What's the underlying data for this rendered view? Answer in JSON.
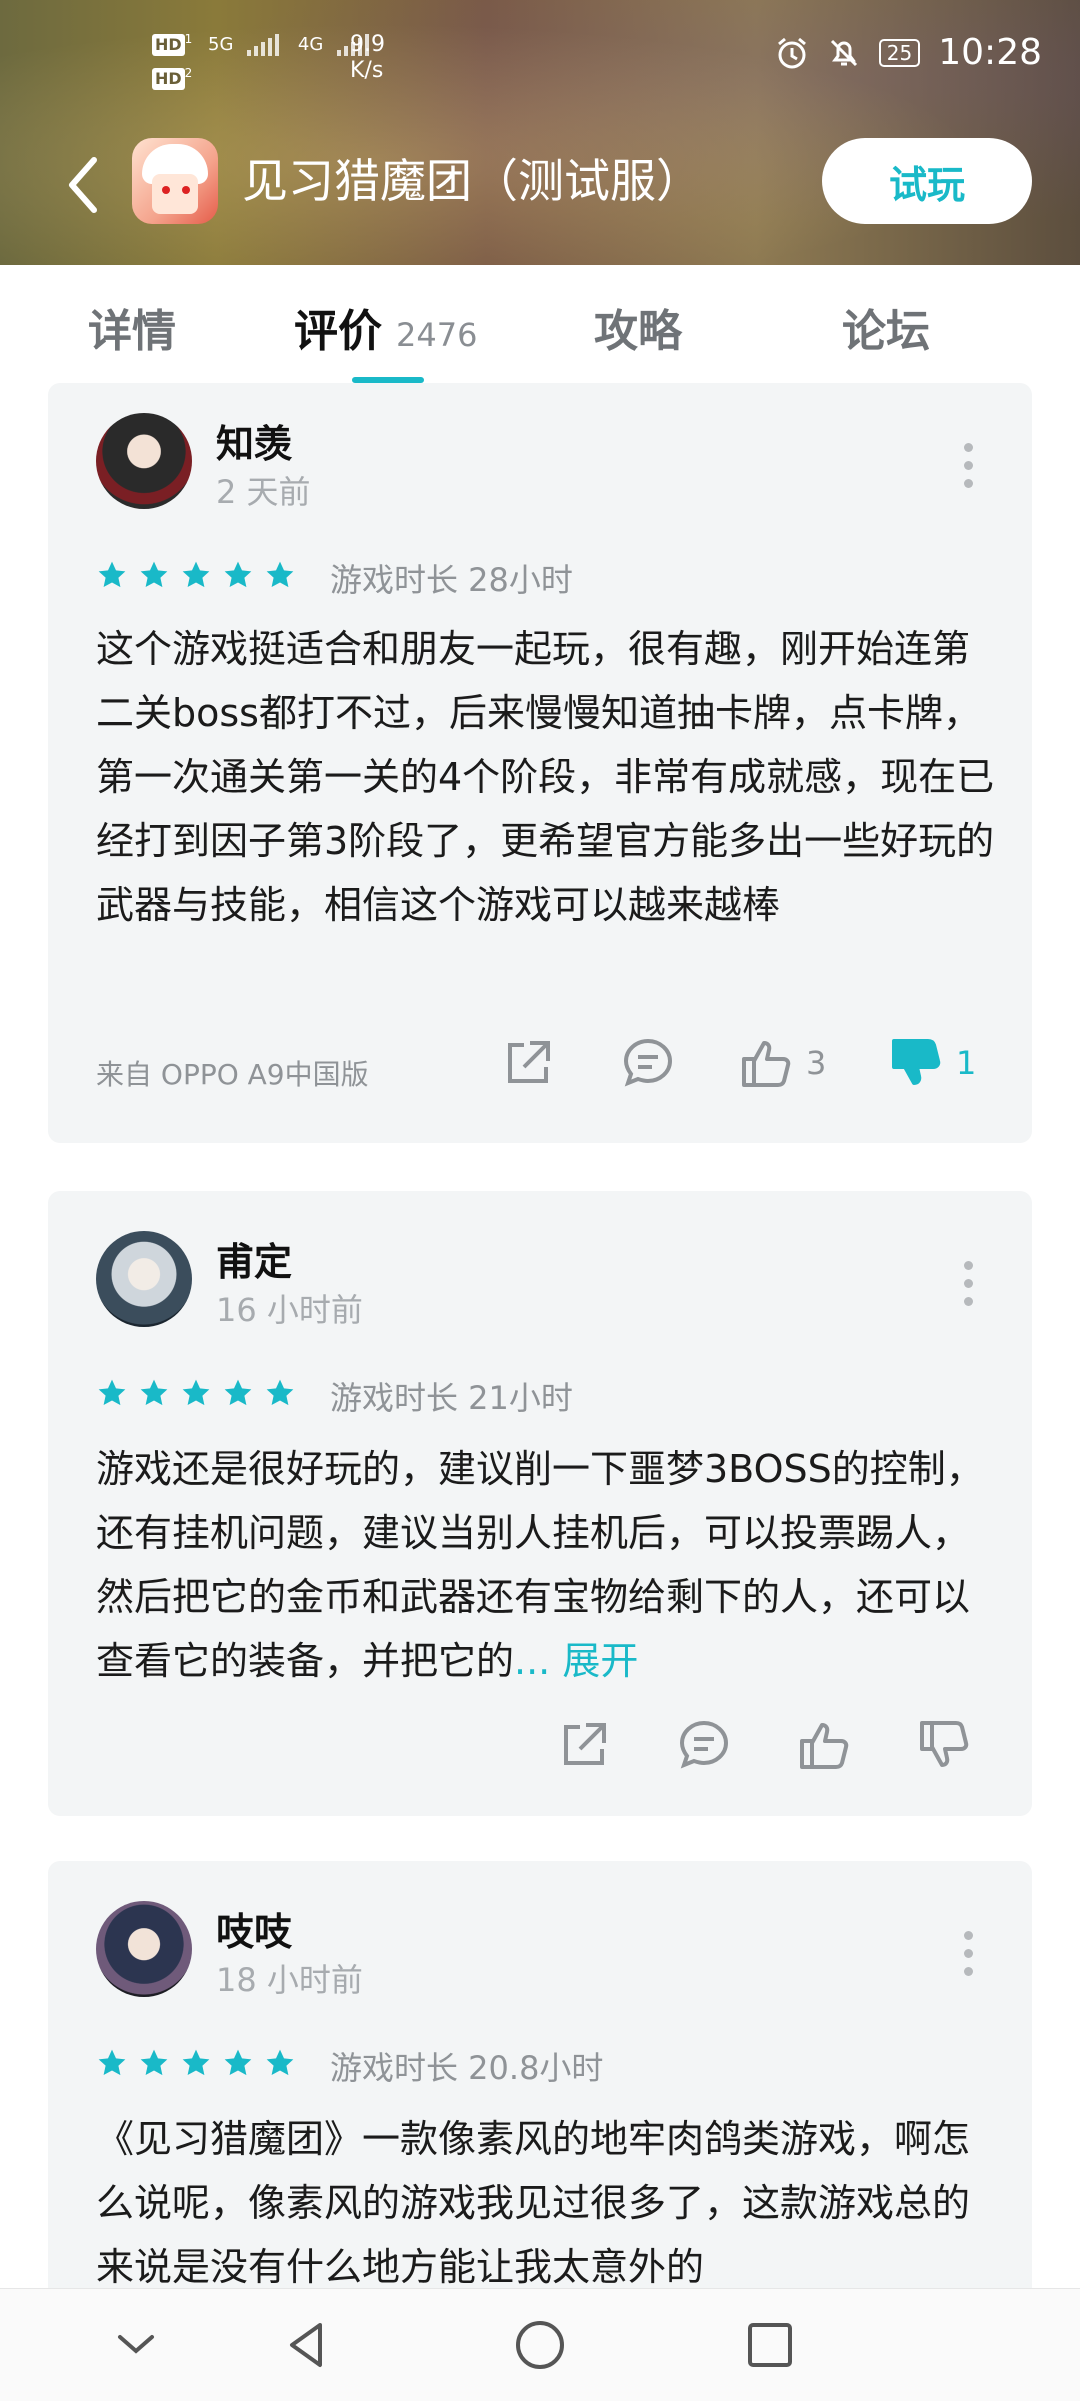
{
  "status_bar": {
    "hd1": "HD",
    "hd2": "HD",
    "net1": "5G",
    "net2": "4G",
    "speed_value": "9.9",
    "speed_unit": "K/s",
    "battery": "25",
    "time": "10:28"
  },
  "header": {
    "title": "见习猎魔团（测试服）",
    "try_button": "试玩"
  },
  "tabs": [
    {
      "label": "详情"
    },
    {
      "label": "评价",
      "count": "2476"
    },
    {
      "label": "攻略"
    },
    {
      "label": "论坛"
    }
  ],
  "reviews": [
    {
      "name": "知羡",
      "time": "2 天前",
      "playtime": "游戏时长 28小时",
      "text": "这个游戏挺适合和朋友一起玩，很有趣，刚开始连第二关boss都打不过，后来慢慢知道抽卡牌，点卡牌，第一次通关第一关的4个阶段，非常有成就感，现在已经打到因子第3阶段了，更希望官方能多出一些好玩的武器与技能，相信这个游戏可以越来越棒",
      "device": "来自 OPPO A9中国版",
      "likes": "3",
      "dislikes": "1"
    },
    {
      "name": "甫定",
      "time": "16 小时前",
      "playtime": "游戏时长 21小时",
      "text": "游戏还是很好玩的，建议削一下噩梦3BOSS的控制，还有挂机问题，建议当别人挂机后，可以投票踢人，然后把它的金币和武器还有宝物给剩下的人，还可以查看它的装备，并把它的",
      "expand": "... 展开"
    },
    {
      "name": "吱吱",
      "time": "18 小时前",
      "playtime": "游戏时长 20.8小时",
      "text": "《见习猎魔团》一款像素风的地牢肉鸽类游戏，啊怎么说呢，像素风的游戏我见过很多了，这款游戏总的来说是没有什么地方能让我太意外的"
    }
  ],
  "colors": {
    "accent": "#19b9c8",
    "card_bg": "#f3f5f6"
  }
}
